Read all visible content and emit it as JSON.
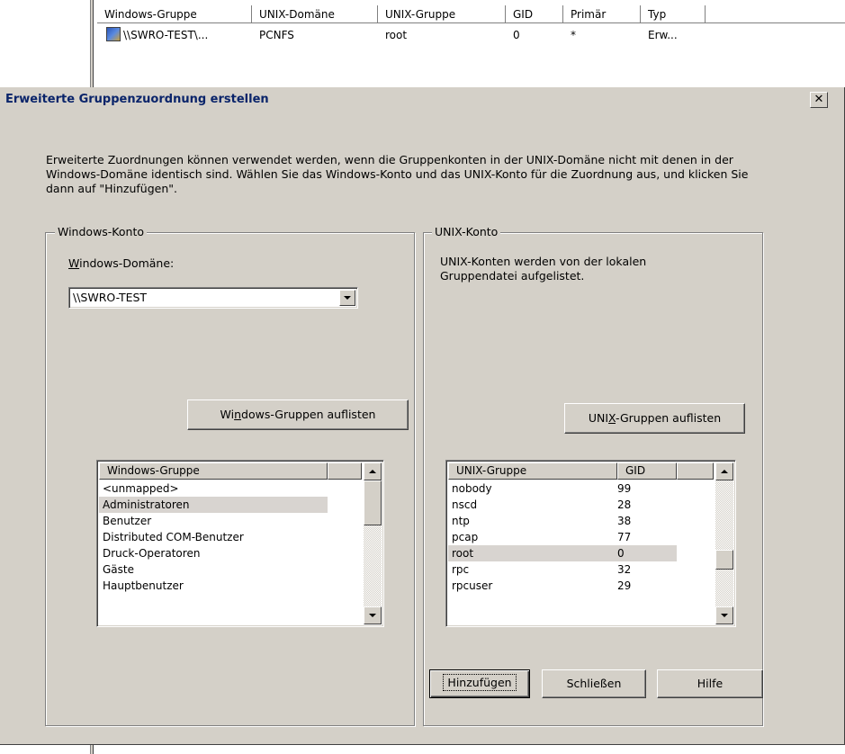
{
  "background_list": {
    "columns": [
      "Windows-Gruppe",
      "UNIX-Domäne",
      "UNIX-Gruppe",
      "GID",
      "Primär",
      "Typ"
    ],
    "row": {
      "windows_group": "\\\\SWRO-TEST\\...",
      "unix_domain": "PCNFS",
      "unix_group": "root",
      "gid": "0",
      "primary": "*",
      "type": "Erw..."
    }
  },
  "dialog": {
    "title": "Erweiterte Gruppenzuordnung erstellen",
    "close_label": "✕",
    "description": "Erweiterte Zuordnungen können verwendet werden, wenn die Gruppenkonten in der UNIX-Domäne nicht mit denen in der Windows-Domäne identisch sind. Wählen Sie das Windows-Konto und das UNIX-Konto für die Zuordnung aus, und klicken Sie dann auf \"Hinzufügen\".",
    "windows_group": {
      "legend": "Windows-Konto",
      "domain_label_prefix": "",
      "domain_label_accel": "W",
      "domain_label_rest": "indows-Domäne:",
      "domain_value": "\\\\SWRO-TEST",
      "list_button_pre": "Wi",
      "list_button_accel": "n",
      "list_button_post": "dows-Gruppen auflisten",
      "list_header": "Windows-Gruppe",
      "items": [
        "<unmapped>",
        "Administratoren",
        "Benutzer",
        "Distributed COM-Benutzer",
        "Druck-Operatoren",
        "Gäste",
        "Hauptbenutzer"
      ],
      "selected_index": 1
    },
    "unix_group": {
      "legend": "UNIX-Konto",
      "info": "UNIX-Konten werden von der lokalen Gruppendatei aufgelistet.",
      "list_button_pre": "UNI",
      "list_button_accel": "X",
      "list_button_post": "-Gruppen auflisten",
      "list_headers": [
        "UNIX-Gruppe",
        "GID"
      ],
      "items": [
        {
          "name": "nobody",
          "gid": "99"
        },
        {
          "name": "nscd",
          "gid": "28"
        },
        {
          "name": "ntp",
          "gid": "38"
        },
        {
          "name": "pcap",
          "gid": "77"
        },
        {
          "name": "root",
          "gid": "0"
        },
        {
          "name": "rpc",
          "gid": "32"
        },
        {
          "name": "rpcuser",
          "gid": "29"
        }
      ],
      "selected_index": 4
    },
    "buttons": {
      "add": "Hinzufügen",
      "close": "Schließen",
      "help": "Hilfe"
    }
  }
}
